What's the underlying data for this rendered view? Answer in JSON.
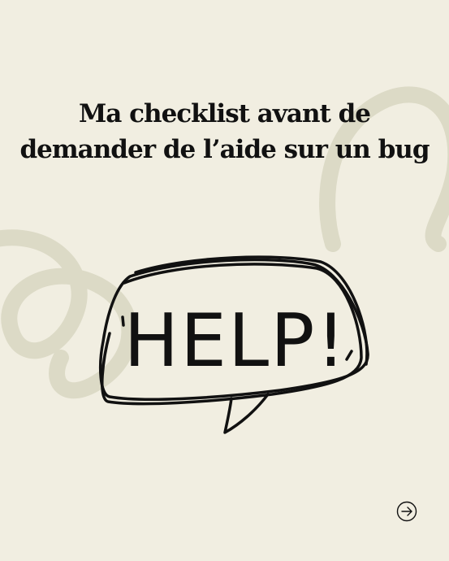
{
  "title": {
    "line1": "Ma checklist avant de",
    "line2": "demander de l’aide sur un bug"
  },
  "illustration": {
    "text": "HELP!",
    "icon": "speech-bubble-icon"
  },
  "navigation": {
    "next_icon": "arrow-right-circle-icon"
  },
  "colors": {
    "background": "#f1eee1",
    "decoration": "#dcdac6",
    "ink": "#111111"
  }
}
